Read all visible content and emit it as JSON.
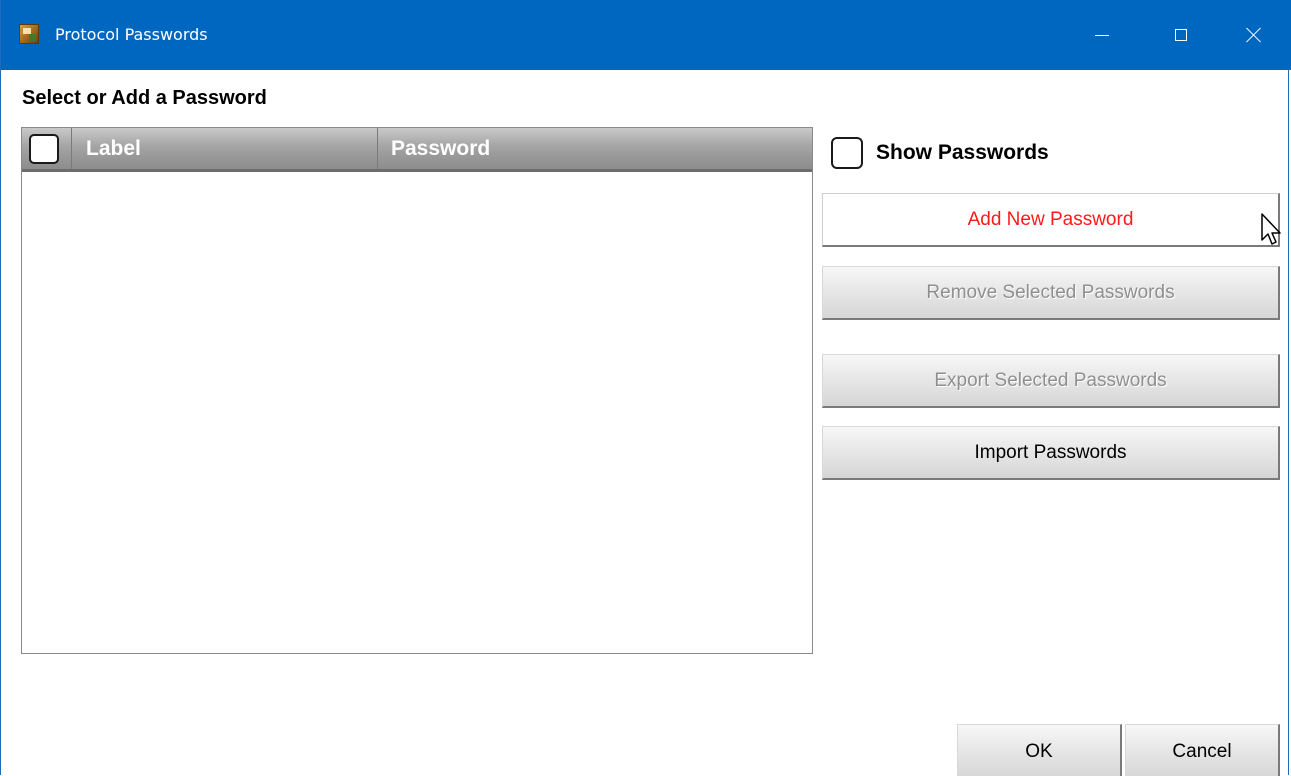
{
  "window": {
    "title": "Protocol Passwords",
    "app_icon": "protocol-app-icon",
    "controls": {
      "minimize": "minimize-icon",
      "maximize": "maximize-icon",
      "close": "close-icon"
    }
  },
  "main": {
    "section_title": "Select or Add a Password",
    "table": {
      "columns": [
        {
          "key": "label",
          "header": "Label"
        },
        {
          "key": "password",
          "header": "Password"
        }
      ],
      "rows": []
    }
  },
  "side": {
    "show_passwords_label": "Show Passwords",
    "show_passwords_checked": false,
    "buttons": {
      "add": "Add New Password",
      "remove": "Remove Selected Passwords",
      "export": "Export Selected Passwords",
      "import": "Import Passwords"
    }
  },
  "footer": {
    "ok": "OK",
    "cancel": "Cancel"
  },
  "colors": {
    "titlebar": "#0067c0",
    "add_button_text": "#ff1a1a",
    "disabled_text": "#8f8f8f"
  }
}
